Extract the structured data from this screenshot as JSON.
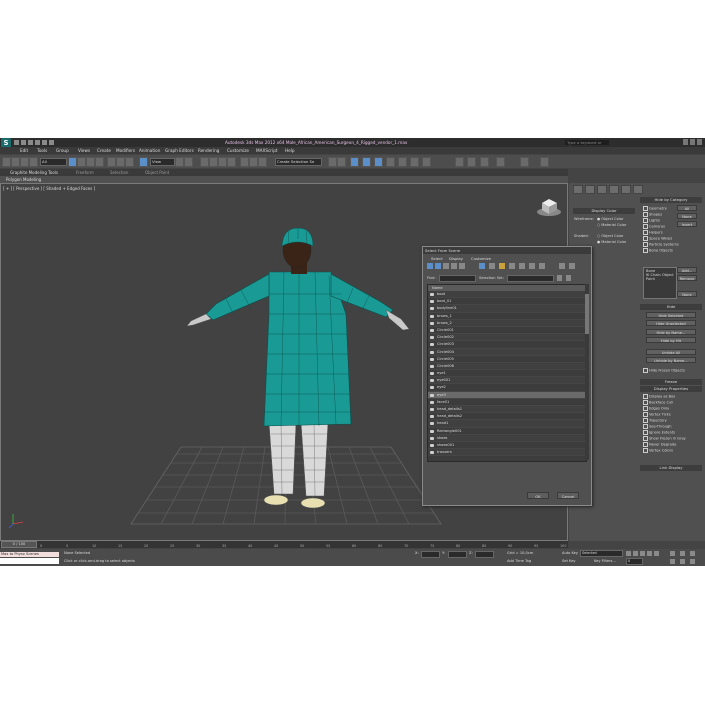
{
  "app": {
    "logo": "S",
    "title": "Autodesk 3ds Max 2012 x64      Male_African_American_Surgeon_4_Rigged_vendor_1.max",
    "search_placeholder": "Type a keyword or phrase"
  },
  "menu": [
    "Edit",
    "Tools",
    "Group",
    "Views",
    "Create",
    "Modifiers",
    "Animation",
    "Graph Editors",
    "Rendering",
    "Customize",
    "MAXScript",
    "Help"
  ],
  "toolbar": {
    "filter_value": "All",
    "ref_coord_value": "View",
    "selection_set_value": "Create Selection Se"
  },
  "ribbon": {
    "tabs": [
      "Graphite Modeling Tools",
      "Freeform",
      "Selection",
      "Object Paint"
    ],
    "active_tab": 0,
    "sub_label": "Polygon Modeling"
  },
  "viewport": {
    "label": "[ + ] [ Perspective ] [ Shaded + Edged Faces ]"
  },
  "display_panel": {
    "display_color_header": "Display Color",
    "wireframe_label": "Wireframe:",
    "shaded_label": "Shaded:",
    "object_color": "Object Color",
    "material_color": "Material Color",
    "hide_by_category_header": "Hide by Category",
    "categories": [
      "Geometry",
      "Shapes",
      "Lights",
      "Cameras",
      "Helpers",
      "Space Warps",
      "Particle Systems",
      "Bone Objects"
    ],
    "all_btn": "All",
    "none_btn": "None",
    "invert_btn": "Invert",
    "list_items": [
      "Bone",
      "IK Chain Object",
      "Point"
    ],
    "add_btn": "Add...",
    "remove_btn": "Remove",
    "none_btn2": "None",
    "hide_header": "Hide",
    "hide_buttons": [
      "Hide Selected",
      "Hide Unselected",
      "Hide by Name...",
      "Hide by Hit",
      "Unhide All",
      "Unhide by Name..."
    ],
    "hide_frozen": "Hide Frozen Objects",
    "freeze_header": "Freeze",
    "display_props_header": "Display Properties",
    "display_props": [
      "Display as Box",
      "Backface Cull",
      "Edges Only",
      "Vertex Ticks",
      "Trajectory",
      "See-Through",
      "Ignore Extents",
      "Show Frozen in Gray",
      "Never Degrade",
      "Vertex Colors"
    ],
    "link_display_header": "Link Display"
  },
  "dialog": {
    "title": "Select From Scene",
    "menu": [
      "Select",
      "Display",
      "Customize"
    ],
    "find_label": "Find:",
    "selection_set_label": "Selection Set:",
    "column_header": "Name",
    "rows": [
      "boot",
      "boot_01",
      "bodyline01",
      "brows_1",
      "brows_2",
      "Circle001",
      "Circle002",
      "Circle003",
      "Circle004",
      "Circle005",
      "Circle006",
      "eye1",
      "eye001",
      "eye2",
      "eye3",
      "face01",
      "head_details1",
      "head_details2",
      "head1",
      "Rectangle001",
      "shoes",
      "shoes001",
      "trousers"
    ],
    "selected_row": 14,
    "ok_btn": "OK",
    "cancel_btn": "Cancel"
  },
  "timeline": {
    "slider_label": "0 / 100",
    "ticks": [
      "0",
      "5",
      "10",
      "15",
      "20",
      "25",
      "30",
      "35",
      "40",
      "45",
      "50",
      "55",
      "60",
      "65",
      "70",
      "75",
      "80",
      "85",
      "90",
      "95",
      "100"
    ]
  },
  "status": {
    "maxscript_line1": "Max to Physx Scenes",
    "maxscript_line2": "",
    "selected_text": "None Selected",
    "prompt_text": "Click or click-and-drag to select objects",
    "x_label": "X:",
    "y_label": "Y:",
    "z_label": "Z:",
    "grid_text": "Grid = 10,0cm",
    "auto_key": "Auto Key",
    "set_key": "Set Key",
    "selected_dropdown": "Selected",
    "key_filters": "Key Filters...",
    "add_time_tag": "Add Time Tag",
    "frame_value": "0"
  },
  "colors": {
    "gown": "#1a9a94",
    "gown_wire": "#0b4f4c",
    "trousers": "#d9d9d9",
    "skin": "#3a2418",
    "grid_line": "#5a5a5a"
  }
}
